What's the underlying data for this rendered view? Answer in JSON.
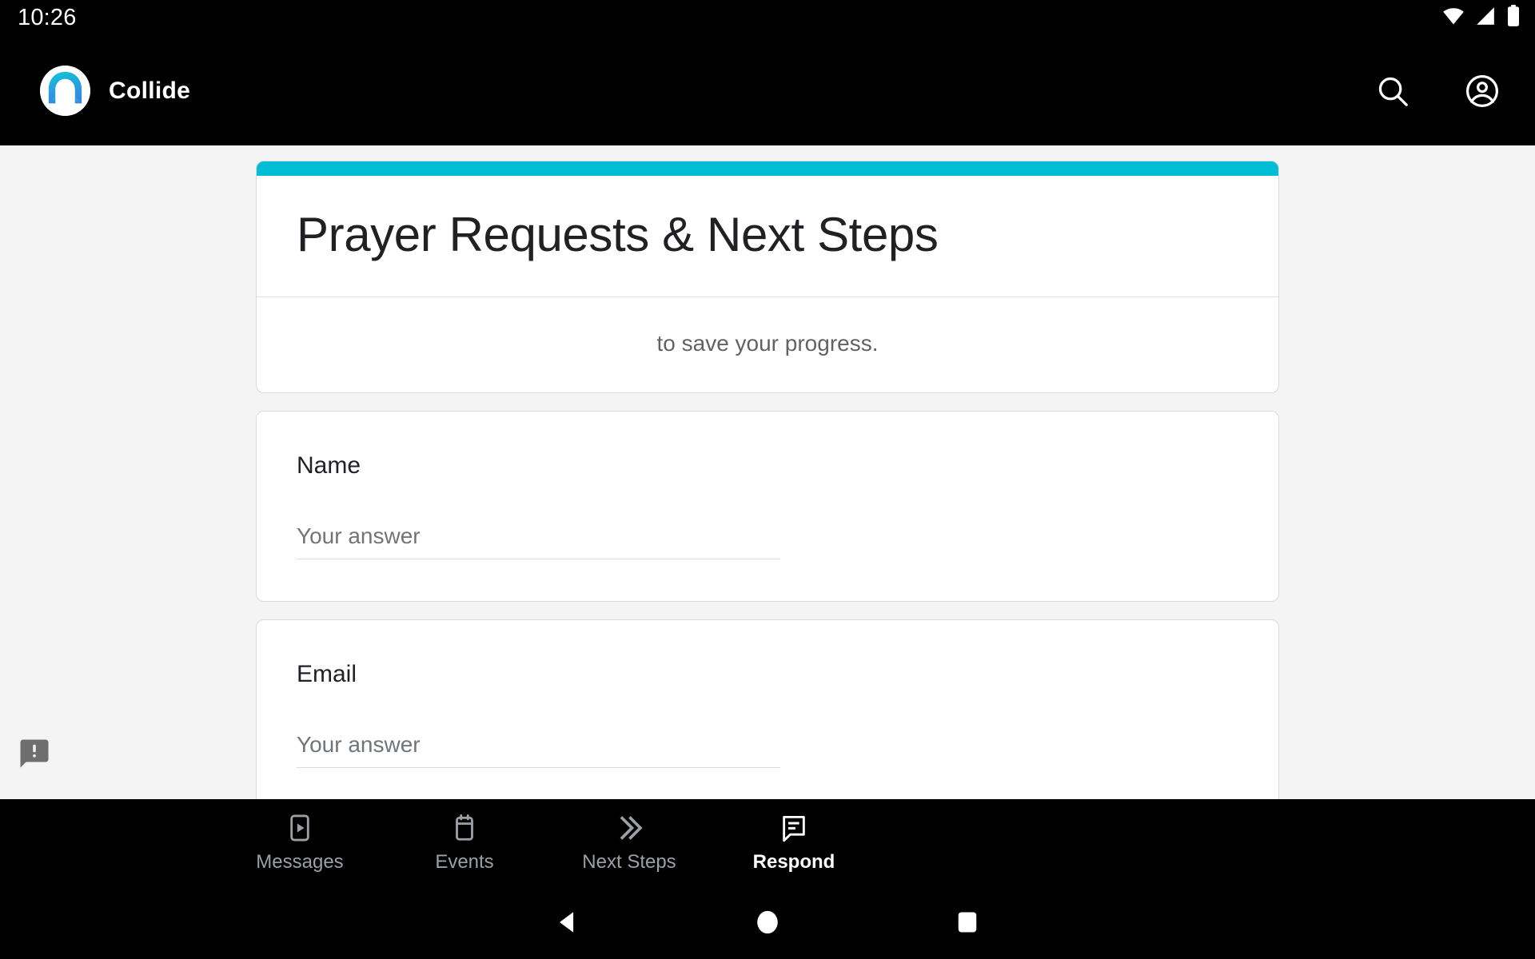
{
  "status_bar": {
    "time": "10:26",
    "icons": [
      "wifi-icon",
      "cell-signal-icon",
      "battery-icon"
    ]
  },
  "app_bar": {
    "brand_name": "Collide",
    "logo_icon": "collide-logo-icon",
    "search_icon": "search-icon",
    "account_icon": "account-circle-icon"
  },
  "form": {
    "accent_color": "#00bcd4",
    "title": "Prayer Requests & Next Steps",
    "description": "to save your progress.",
    "questions": [
      {
        "label": "Name",
        "placeholder": "Your answer",
        "value": ""
      },
      {
        "label": "Email",
        "placeholder": "Your answer",
        "value": ""
      }
    ]
  },
  "feedback": {
    "icon": "feedback-icon"
  },
  "bottom_nav": {
    "items": [
      {
        "label": "Messages",
        "icon": "smart-display-icon",
        "active": false
      },
      {
        "label": "Events",
        "icon": "calendar-icon",
        "active": false
      },
      {
        "label": "Next Steps",
        "icon": "double-chevron-right-icon",
        "active": false
      },
      {
        "label": "Respond",
        "icon": "speaker-notes-icon",
        "active": true
      }
    ],
    "active_color": "#ffffff",
    "inactive_color": "#9aa0a6"
  },
  "android_nav": {
    "back": "back-triangle-icon",
    "home": "home-circle-icon",
    "recents": "recents-square-icon"
  }
}
